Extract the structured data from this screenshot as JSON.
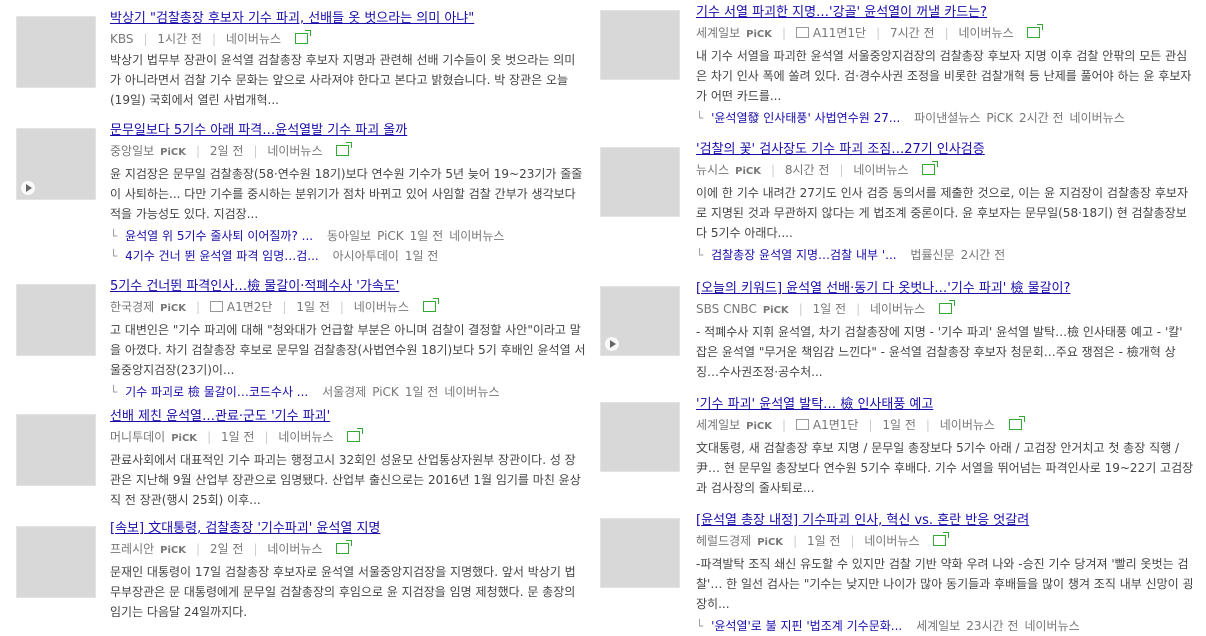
{
  "left": [
    {
      "title": "박상기 \"검찰총장 후보자 기수 파괴, 선배들 옷 벗으라는 의미 아냐\"",
      "meta": [
        "KBS",
        "1시간 전",
        "네이버뉴스"
      ],
      "desc": "박상기 법무부 장관이 윤석열 검찰총장 후보자 지명과 관련해 선배 기수들이 옷 벗으라는 의미가 아니라면서 검찰 기수 문화는 앞으로 사라져야 한다고 본다고 밝혔습니다. 박 장관은 오늘(19일) 국회에서 열린 사법개혁..."
    },
    {
      "title": "문무일보다 5기수 아래 파격…윤석열발 기수 파괴 올까",
      "meta": [
        "중앙일보",
        "PiCK",
        "2일 전",
        "네이버뉴스"
      ],
      "desc": "윤 지검장은 문무일 검찰총장(58·연수원 18기)보다 연수원 기수가 5년 늦어 19~23기가 줄줄이 사퇴하는... 다만 기수를 중시하는 분위기가 점차 바뀌고 있어 사임할 검찰 간부가 생각보다 적을 가능성도 있다. 지검장...",
      "related": [
        {
          "title": "윤석열 위 5기수 줄사퇴 이어질까? ...",
          "source": "동아일보",
          "pick": "PiCK",
          "time": "1일 전",
          "naver": "네이버뉴스"
        },
        {
          "title": "4기수 건너 뛴 윤석열 파격 임명…검...",
          "source": "아시아투데이",
          "time": "1일 전"
        }
      ]
    },
    {
      "title": "5기수 건너뛴 파격인사…檢 물갈이·적폐수사 '가속도'",
      "meta": [
        "한국경제",
        "PiCK",
        "A1면2단",
        "1일 전",
        "네이버뉴스"
      ],
      "desc": "고 대변인은 \"기수 파괴에 대해 \"청와대가 언급할 부분은 아니며 검찰이 결정할 사안\"이라고 말을 아꼈다. 차기 검찰총장 후보로 문무일 검찰총장(사법연수원 18기)보다 5기 후배인 윤석열 서울중앙지검장(23기)이...",
      "related": [
        {
          "title": "기수 파괴로 檢 물갈이…코드수사 ...",
          "source": "서울경제",
          "pick": "PiCK",
          "time": "1일 전",
          "naver": "네이버뉴스"
        }
      ]
    },
    {
      "title": "선배 제친 윤석열…관료·군도 '기수 파괴'",
      "meta": [
        "머니투데이",
        "PiCK",
        "1일 전",
        "네이버뉴스"
      ],
      "desc": "관료사회에서 대표적인 기수 파괴는 행정고시 32회인 성윤모 산업통상자원부 장관이다. 성 장관은 지난해 9월 산업부 장관으로 임명됐다. 산업부 출신으로는 2016년 1월 임기를 마친 윤상직 전 장관(행시 25회) 이후..."
    },
    {
      "title": "[속보] 文대통령, 검찰총장 '기수파괴' 윤석열 지명",
      "meta": [
        "프레시안",
        "PiCK",
        "2일 전",
        "네이버뉴스"
      ],
      "desc": "문재인 대통령이 17일 검찰총장 후보자로 윤석열 서울중앙지검장을 지명했다. 앞서 박상기 법무부장관은 문 대통령에게 문무일 검찰총장의 후임으로 윤 지검장을 임명 제청했다. 문 총장의 임기는 다음달 24일까지다."
    }
  ],
  "right": [
    {
      "title": "기수 서열 파괴한 지명…'강골' 윤석열이 꺼낼 카드는?",
      "meta": [
        "세계일보",
        "PiCK",
        "A11면1단",
        "7시간 전",
        "네이버뉴스"
      ],
      "desc": "내 기수 서열을 파괴한 윤석열 서울중앙지검장의 검찰총장 후보자 지명 이후 검찰 안팎의 모든 관심은 차기 인사 폭에 쏠려 있다. 검·경수사권 조정을 비롯한 검찰개혁 등 난제를 풀어야 하는 윤 후보자가 어떤 카드를...",
      "related": [
        {
          "title": "'윤석열發 인사태풍' 사법연수원 27...",
          "source": "파이낸셜뉴스",
          "pick": "PiCK",
          "time": "2시간 전",
          "naver": "네이버뉴스"
        }
      ]
    },
    {
      "title": "'검찰의 꽃' 검사장도 기수 파괴 조짐…27기 인사검증",
      "meta": [
        "뉴시스",
        "PiCK",
        "8시간 전",
        "네이버뉴스"
      ],
      "desc": "이에 한 기수 내려간 27기도 인사 검증 동의서를 제출한 것으로, 이는 윤 지검장이 검찰총장 후보자로 지명된 것과 무관하지 않다는 게 법조계 중론이다. 윤 후보자는 문무일(58·18기) 현 검찰총장보다 5기수 아래다....",
      "related": [
        {
          "title": "검찰총장 윤석열 지명…검찰 내부 '...",
          "source": "법률신문",
          "time": "2시간 전"
        }
      ]
    },
    {
      "title": "[오늘의 키워드] 윤석열 선배·동기 다 옷벗나…'기수 파괴' 檢 물갈이?",
      "meta": [
        "SBS CNBC",
        "PiCK",
        "1일 전",
        "네이버뉴스"
      ],
      "desc": "- 적폐수사 지휘 윤석열, 차기 검찰총장에 지명 - '기수 파괴' 윤석열 발탁…檢 인사태풍 예고 - '칼' 잡은 윤석열 \"무거운 책임감 느낀다\" - 윤석열 검찰총장 후보자 청문회…주요 쟁점은 - 檢개혁 상징…수사권조정·공수처..."
    },
    {
      "title": "'기수 파괴' 윤석열 발탁… 檢 인사태풍 예고",
      "meta": [
        "세계일보",
        "PiCK",
        "A1면1단",
        "1일 전",
        "네이버뉴스"
      ],
      "desc": "文대통령, 새 검찰총장 후보 지명 / 문무일 총장보다 5기수 아래 / 고검장 안거치고 첫 총장 직행 / 尹… 현 문무일 총장보다 연수원 5기수 후배다. 기수 서열을 뛰어넘는 파격인사로 19~22기 고검장과 검사장의 줄사퇴로..."
    },
    {
      "title": "[윤석열 총장 내정] 기수파괴 인사, 혁신 vs. 혼란 반응 엇갈려",
      "meta": [
        "헤럴드경제",
        "PiCK",
        "1일 전",
        "네이버뉴스"
      ],
      "desc": "-파격발탁 조직 쇄신 유도할 수 있지만 검찰 기반 약화 우려 나와 -승진 기수 당겨져 '빨리 옷벗는 검찰'… 한 일선 검사는 \"기수는 낮지만 나이가 많아 동기들과 후배들을 많이 챙겨 조직 내부 신망이 굉장히...",
      "related": [
        {
          "title": "'윤석열'로 불 지핀 '법조계 기수문화...",
          "source": "세계일보",
          "time": "23시간 전",
          "naver": "네이버뉴스"
        }
      ]
    }
  ],
  "colors": {
    "link": "#1a0dab",
    "meta": "#777777",
    "share": "#33aa33"
  }
}
